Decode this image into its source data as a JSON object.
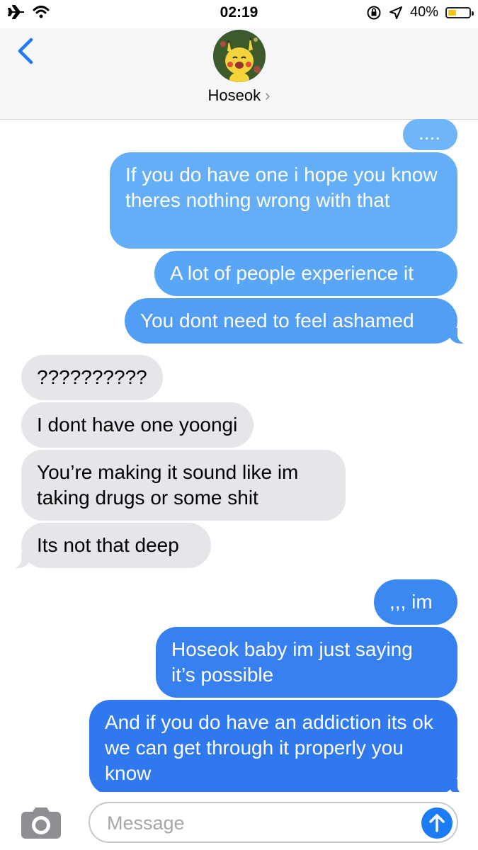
{
  "status": {
    "time": "02:19",
    "battery": "40%",
    "battery_level": 0.4
  },
  "header": {
    "contact_name": "Hoseok",
    "chevron": "›"
  },
  "messages": [
    {
      "from": "me",
      "text": "...."
    },
    {
      "from": "me",
      "text": "If you do have one i hope you know theres nothing wrong with that"
    },
    {
      "from": "me",
      "text": "A lot of people experience it"
    },
    {
      "from": "me",
      "text": "You dont need to feel ashamed"
    },
    {
      "from": "them",
      "text": "??????????"
    },
    {
      "from": "them",
      "text": "I dont have one yoongi"
    },
    {
      "from": "them",
      "text": "You’re making it sound like im taking drugs or some shit"
    },
    {
      "from": "them",
      "text": "Its not that deep"
    },
    {
      "from": "me",
      "text": ",,, im"
    },
    {
      "from": "me",
      "text": "Hoseok baby im just saying it’s possible"
    },
    {
      "from": "me",
      "text": "And if you do have an addiction its ok we can get through it properly you know"
    }
  ],
  "input": {
    "placeholder": "Message"
  },
  "icons": {
    "status_left": [
      "airplane-icon",
      "wifi-icon"
    ],
    "status_right": [
      "orientation-lock-icon",
      "location-icon",
      "battery-icon"
    ],
    "header": [
      "back-chevron-icon",
      "avatar"
    ],
    "input_bar": [
      "camera-icon",
      "send-arrow-icon"
    ]
  },
  "colors": {
    "accent": "#1b7cf5",
    "received_bubble": "#e5e5ea",
    "sent_gradient_top": "#6cb4f7",
    "sent_gradient_bottom": "#2f72ee",
    "battery_fill": "#f5c518"
  }
}
